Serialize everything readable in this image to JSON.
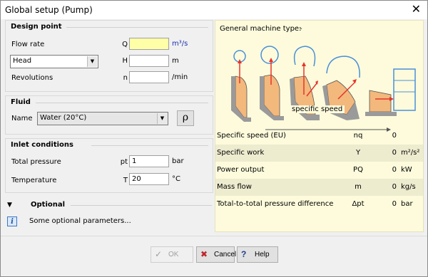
{
  "window": {
    "title": "Global setup (Pump)",
    "close_glyph": "✕"
  },
  "design_point": {
    "title": "Design point",
    "flow_rate": {
      "label": "Flow rate",
      "symbol": "Q",
      "value": "",
      "unit": "m³/s"
    },
    "head": {
      "selected": "Head",
      "symbol": "H",
      "value": "",
      "unit": "m"
    },
    "revolutions": {
      "label": "Revolutions",
      "symbol": "n",
      "value": "",
      "unit": "/min"
    }
  },
  "fluid": {
    "title": "Fluid",
    "name_label": "Name",
    "selected": "Water (20°C)",
    "rho_button": "ρ"
  },
  "inlet": {
    "title": "Inlet conditions",
    "total_pressure": {
      "label": "Total pressure",
      "symbol": "pt",
      "value": "1",
      "unit": "bar"
    },
    "temperature": {
      "label": "Temperature",
      "symbol": "T",
      "value": "20",
      "unit": "°C"
    }
  },
  "optional": {
    "title": "Optional",
    "info_text": "Some optional parameters...",
    "info_glyph": "i",
    "arrow_glyph": "▼"
  },
  "machine": {
    "header_label": "General machine type:",
    "header_value": "-",
    "speed_label": "specific speed",
    "accent_color": "#e8332a",
    "impeller_color": "#f3b87c",
    "wireframe_color": "#4a90d9"
  },
  "results": [
    {
      "name": "Specific speed (EU)",
      "symbol": "nq",
      "value": "0",
      "unit": ""
    },
    {
      "name": "Specific work",
      "symbol": "Y",
      "value": "0",
      "unit": "m²/s²"
    },
    {
      "name": "Power output",
      "symbol": "PQ",
      "value": "0",
      "unit": "kW"
    },
    {
      "name": "Mass flow",
      "symbol": "m",
      "value": "0",
      "unit": "kg/s"
    },
    {
      "name": "Total-to-total pressure difference",
      "symbol": "Δpt",
      "value": "0",
      "unit": "bar"
    }
  ],
  "buttons": {
    "ok": {
      "label": "OK",
      "icon": "✓"
    },
    "cancel": {
      "label": "Cancel",
      "icon": "✖"
    },
    "help": {
      "label": "Help",
      "icon": "?"
    }
  }
}
